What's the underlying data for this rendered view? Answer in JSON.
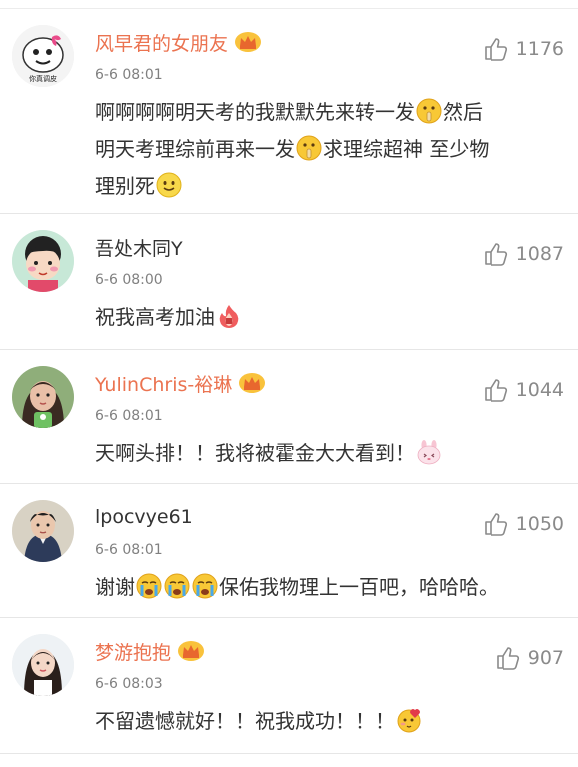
{
  "comments": [
    {
      "username": "风早君的女朋友",
      "vip": true,
      "time": "6-6 08:01",
      "likes": "1176",
      "avatar": "meme-face-avatar",
      "avatar_caption": "你真调皮",
      "lines": [
        [
          {
            "t": "啊啊啊啊明天考的我默默先来转一发"
          },
          {
            "e": "shush-emoji"
          },
          {
            "t": "然后"
          }
        ],
        [
          {
            "t": "明天考理综前再来一发"
          },
          {
            "e": "shush-emoji"
          },
          {
            "t": "求理综超神 至少物"
          }
        ],
        [
          {
            "t": "理别死"
          },
          {
            "e": "smile-emoji"
          }
        ]
      ]
    },
    {
      "username": "吾处木同Y",
      "vip": false,
      "time": "6-6 08:00",
      "likes": "1087",
      "avatar": "cartoon-girl-avatar",
      "lines": [
        [
          {
            "t": "祝我高考加油"
          },
          {
            "e": "fire-emoji"
          }
        ]
      ]
    },
    {
      "username": "YulinChris-裕琳",
      "vip": true,
      "time": "6-6 08:01",
      "likes": "1044",
      "avatar": "photo-girl-avatar",
      "lines": [
        [
          {
            "t": "天啊头排！！我将被霍金大大看到！"
          },
          {
            "e": "bunny-emoji"
          }
        ]
      ]
    },
    {
      "username": "lpocvye61",
      "vip": false,
      "time": "6-6 08:01",
      "likes": "1050",
      "avatar": "photo-boy-avatar",
      "lines": [
        [
          {
            "t": "谢谢"
          },
          {
            "e": "cry-emoji"
          },
          {
            "e": "cry-emoji"
          },
          {
            "e": "cry-emoji"
          },
          {
            "t": "保佑我物理上一百吧，哈哈哈。"
          }
        ]
      ]
    },
    {
      "username": "梦游抱抱",
      "vip": true,
      "time": "6-6 08:03",
      "likes": "907",
      "avatar": "photo-woman-avatar",
      "lines": [
        [
          {
            "t": "不留遗憾就好！！祝我成功！！！"
          },
          {
            "e": "love-emoji"
          }
        ]
      ]
    }
  ],
  "colors": {
    "vip_name": "#eb7350",
    "name": "#333333",
    "meta": "#808080",
    "divider": "#e6e6e6"
  }
}
